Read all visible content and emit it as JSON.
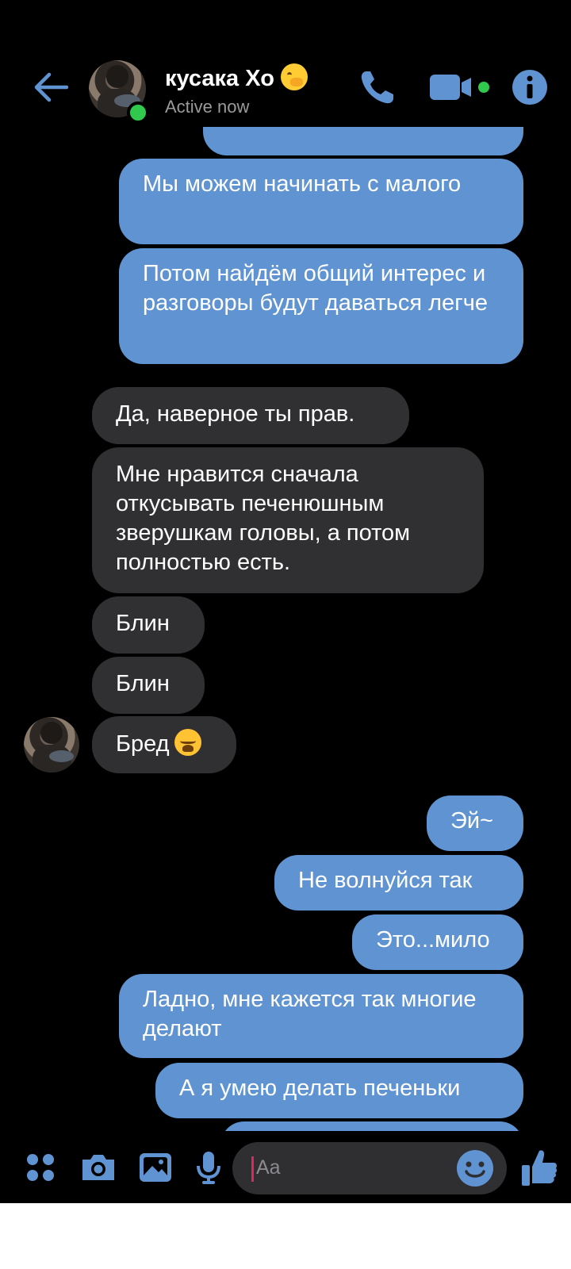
{
  "header": {
    "contact_name": "кусака Хо",
    "status": "Active now",
    "name_emoji_icon": "face-with-hand-over-mouth-icon",
    "icons": [
      "back-arrow-icon",
      "phone-icon",
      "video-camera-icon",
      "info-icon"
    ]
  },
  "messages": [
    {
      "side": "out",
      "text": "Мы можем начинать с малого"
    },
    {
      "side": "out",
      "text": "Потом найдём общий интерес и разговоры будут даваться легче"
    },
    {
      "side": "in",
      "text": "Да, наверное ты прав."
    },
    {
      "side": "in",
      "text": "Мне нравится сначала откусывать печенюшным зверушкам головы, а потом полностью есть."
    },
    {
      "side": "in",
      "text": "Блин"
    },
    {
      "side": "in",
      "text": "Блин"
    },
    {
      "side": "in",
      "text": "Бред",
      "emoji": "weary-face-icon"
    },
    {
      "side": "out",
      "text": "Эй~"
    },
    {
      "side": "out",
      "text": "Не волнуйся так"
    },
    {
      "side": "out",
      "text": "Это...мило"
    },
    {
      "side": "out",
      "text": "Ладно, мне кажется так многие делают"
    },
    {
      "side": "out",
      "text": "А я умею делать печеньки"
    }
  ],
  "composer": {
    "placeholder": "Aa",
    "icons": [
      "menu-dots-icon",
      "camera-icon",
      "gallery-icon",
      "microphone-icon",
      "emoji-icon",
      "thumbs-up-icon"
    ]
  },
  "colors": {
    "accent": "#5f93d2",
    "background": "#000000",
    "incoming_bubble": "#302f31",
    "online": "#31c94d"
  }
}
